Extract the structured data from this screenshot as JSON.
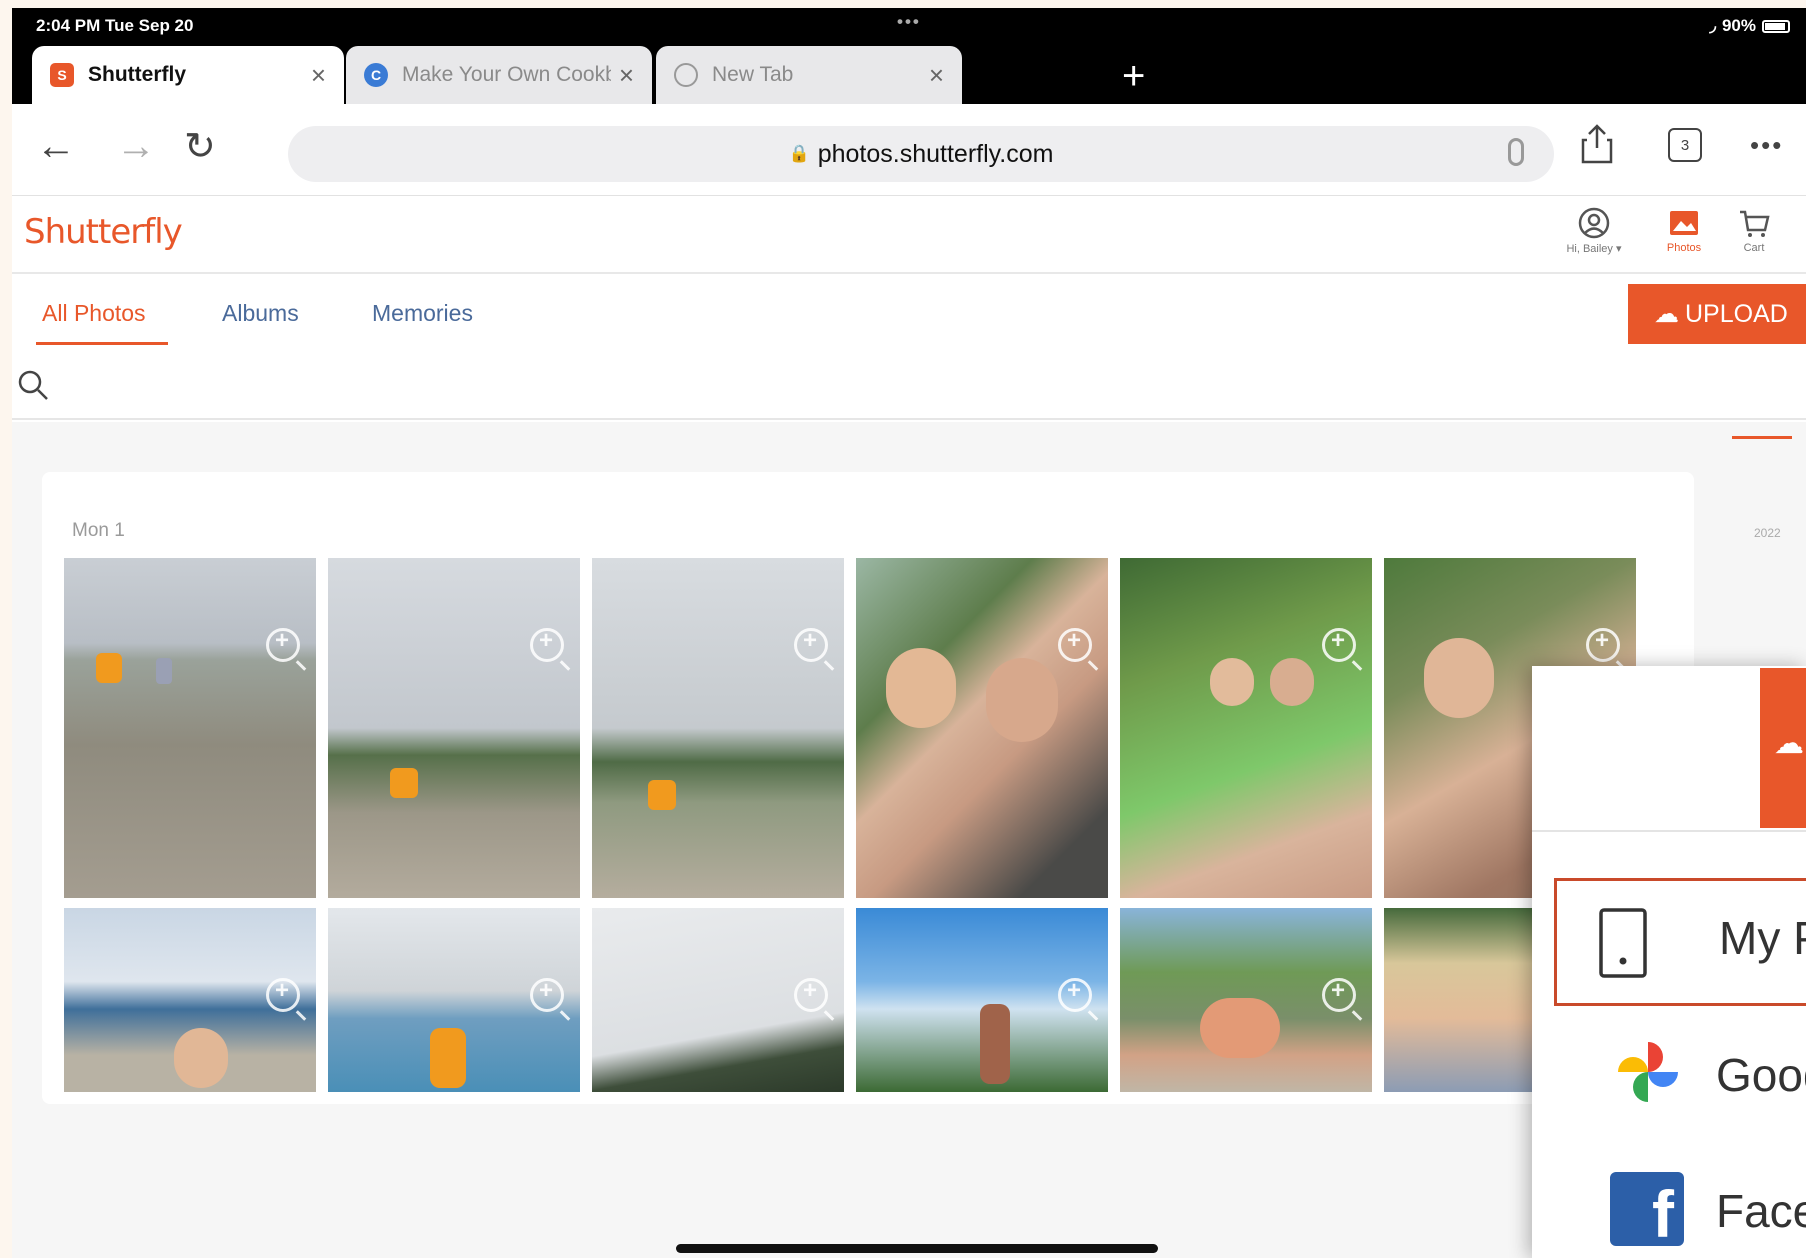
{
  "status_bar": {
    "time": "2:04 PM  Tue Sep 20",
    "battery": "90%"
  },
  "browser": {
    "tabs": [
      {
        "title": "Shutterfly",
        "favicon_letter": "S",
        "favicon_color": "#e8572a",
        "active": true
      },
      {
        "title": "Make Your Own Cookbo",
        "favicon_letter": "C",
        "favicon_color": "#3a7bd5",
        "active": false
      },
      {
        "title": "New Tab",
        "favicon_letter": "",
        "favicon_color": "#999999",
        "active": false
      }
    ],
    "url": "photos.shutterfly.com",
    "tab_count": "3"
  },
  "header": {
    "logo": "Shutterfly",
    "account_label": "Hi, Bailey ▾",
    "photos_label": "Photos",
    "cart_label": "Cart"
  },
  "subnav": {
    "tabs": [
      "All Photos",
      "Albums",
      "Memories"
    ],
    "upload_label": "UPLOAD"
  },
  "search": {
    "value": "",
    "placeholder": ""
  },
  "main": {
    "date_group": "Mon 1",
    "year_marker": "2022"
  },
  "upload_menu": {
    "items": [
      "My Photos",
      "Google Photos",
      "Facebook"
    ]
  },
  "colors": {
    "accent": "#e8572a",
    "link": "#4a6a9a"
  }
}
